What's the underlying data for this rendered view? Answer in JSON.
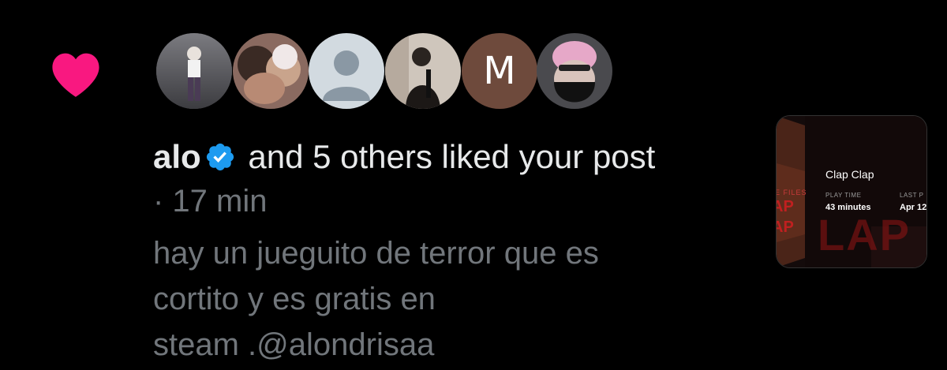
{
  "notification": {
    "type_icon": "heart-icon",
    "heart_color": "#f91880",
    "avatars": [
      {
        "kind": "photo",
        "name": "avatar-1"
      },
      {
        "kind": "photo",
        "name": "avatar-2"
      },
      {
        "kind": "default",
        "name": "avatar-3"
      },
      {
        "kind": "photo",
        "name": "avatar-4"
      },
      {
        "kind": "letter",
        "name": "avatar-5",
        "letter": "M"
      },
      {
        "kind": "photo",
        "name": "avatar-6"
      }
    ],
    "user_name": "alo",
    "verified_icon": "verified-badge-icon",
    "verified_color": "#1d9bf0",
    "action_text": "and 5 others liked your post",
    "time_text": "· 17 min",
    "post_lines": [
      "hay un jueguito de terror que es",
      "cortito y es gratis en",
      "steam .@alondrisaa"
    ]
  },
  "media_thumbnail": {
    "game_title": "Clap Clap",
    "play_time_label": "PLAY TIME",
    "play_time_value": "43 minutes",
    "last_played_label": "LAST P",
    "last_played_value": "Apr 12",
    "art_text_files": "E FILES",
    "art_text_ap1": "AP",
    "art_text_ap2": "AP",
    "art_text_big": "LAP"
  }
}
